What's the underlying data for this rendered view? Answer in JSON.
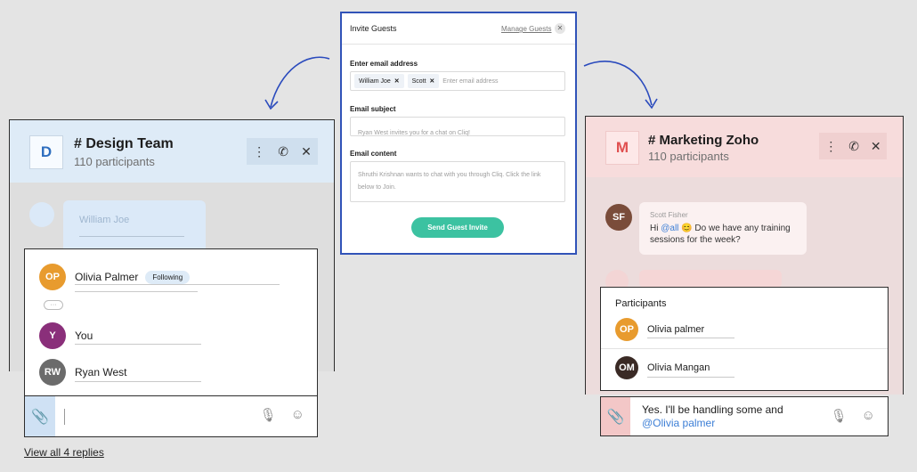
{
  "left_chat": {
    "avatar_letter": "D",
    "title": "# Design Team",
    "participants": "110 participants",
    "ghost_name": "William Joe",
    "thread": {
      "items": [
        {
          "name": "Olivia Palmer",
          "badge": "Following"
        },
        {
          "name": "You"
        },
        {
          "name": "Ryan West"
        }
      ],
      "more_indicator": "···"
    },
    "view_replies": "View all 4 replies"
  },
  "invite_modal": {
    "title": "Invite Guests",
    "manage_link": "Manage Guests",
    "email_label": "Enter email address",
    "chips": [
      "William Joe",
      "Scott"
    ],
    "email_placeholder": "Enter email address",
    "subject_label": "Email subject",
    "subject_value": "Ryan West invites you for a chat on Cliq!",
    "content_label": "Email content",
    "content_value": "Shruthi Krishnan wants to chat with you through Cliq. Click the link below to Join.",
    "send_button": "Send Guest Invite"
  },
  "right_chat": {
    "avatar_letter": "M",
    "title": "# Marketing Zoho",
    "participants": "110 participants",
    "message": {
      "sender": "Scott Fisher",
      "text_prefix": "Hi",
      "mention": "@all",
      "emoji": "😊",
      "text": "Do we have any training sessions for the week?"
    },
    "participants_panel": {
      "title": "Participants",
      "items": [
        "Olivia palmer",
        "Olivia Mangan"
      ]
    },
    "composer": {
      "text": "Yes. I'll be handling some and",
      "mention": "@Olivia palmer"
    }
  },
  "colors": {
    "accent_blue": "#3153b8",
    "send_green": "#3cc2a1",
    "left_header": "#deebf7",
    "right_header": "#f7dcdc"
  }
}
